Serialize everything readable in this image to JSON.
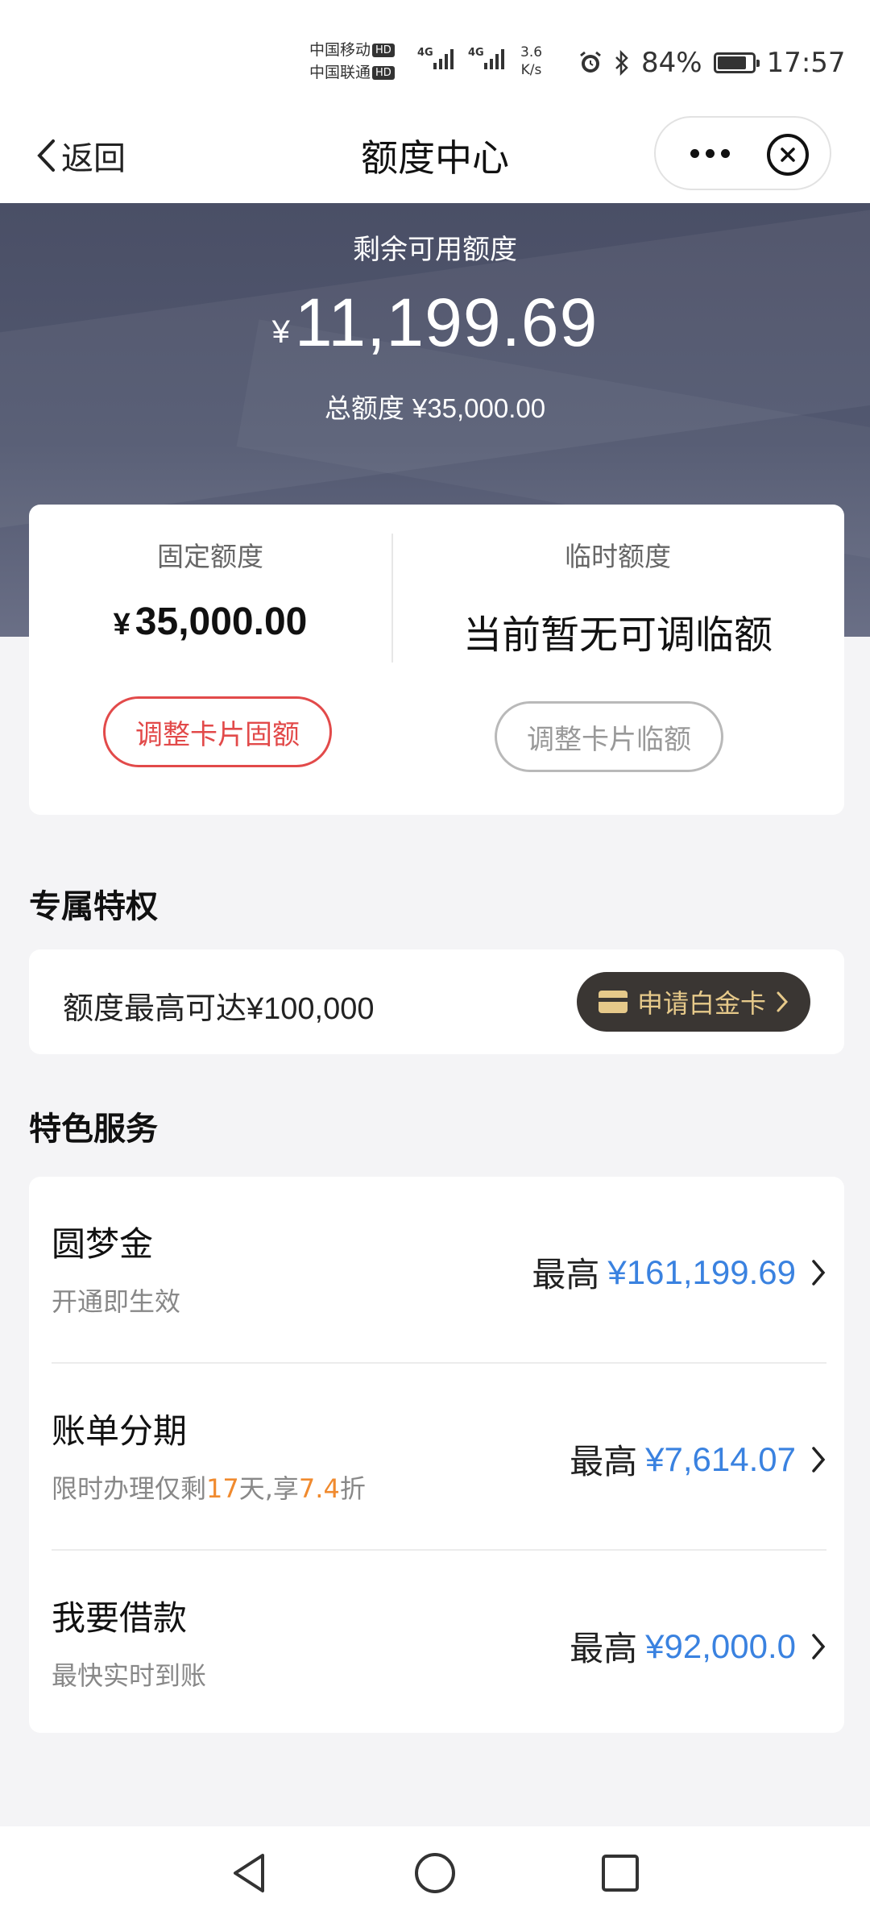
{
  "status_bar": {
    "carrier_1": "中国移动",
    "carrier_2": "中国联通",
    "hd_tag": "HD",
    "network_1": "4G",
    "network_2": "4G",
    "net_speed_value": "3.6",
    "net_speed_unit": "K/s",
    "battery_percent": "84%",
    "battery_level": 0.84,
    "time": "17:57"
  },
  "nav": {
    "back_label": "返回",
    "title": "额度中心"
  },
  "hero": {
    "label": "剩余可用额度",
    "currency": "¥",
    "amount": "11,199.69",
    "total_label": "总额度",
    "total_value": "¥35,000.00"
  },
  "quota": {
    "fixed_label": "固定额度",
    "fixed_currency": "¥",
    "fixed_value": "35,000.00",
    "fixed_button": "调整卡片固额",
    "temp_label": "临时额度",
    "temp_value": "当前暂无可调临额",
    "temp_button": "调整卡片临额"
  },
  "privilege": {
    "section_title": "专属特权",
    "text": "额度最高可达",
    "amount": "¥100,000",
    "button": "申请白金卡"
  },
  "services": {
    "section_title": "特色服务",
    "max_label": "最高",
    "items": [
      {
        "title": "圆梦金",
        "subtitle": "开通即生效",
        "value": "¥161,199.69"
      },
      {
        "title": "账单分期",
        "subtitle_pre": "限时办理仅剩",
        "subtitle_days": "17",
        "subtitle_mid": "天,享",
        "subtitle_discount": "7.4",
        "subtitle_post": "折",
        "value": "¥7,614.07"
      },
      {
        "title": "我要借款",
        "subtitle": "最快实时到账",
        "value": "¥92,000.0"
      }
    ]
  },
  "colors": {
    "accent_blue": "#3a82e0",
    "accent_red": "#e24a4a",
    "highlight_orange": "#f08a2e",
    "platinum_gold": "#e6c98a",
    "hero_bg": "#4f556d"
  }
}
